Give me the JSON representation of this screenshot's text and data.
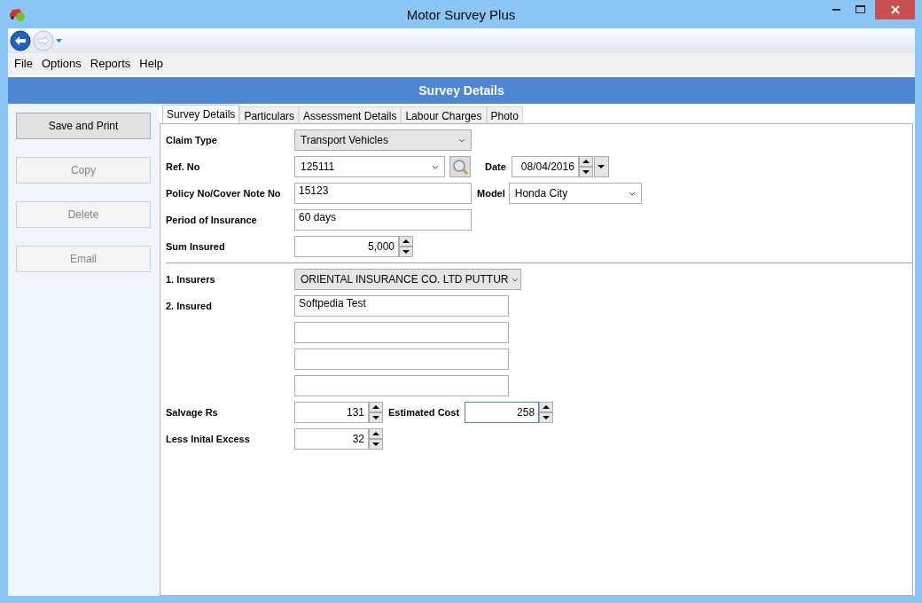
{
  "window": {
    "title": "Motor Survey Plus"
  },
  "menu": [
    "File",
    "Options",
    "Reports",
    "Help"
  ],
  "header": "Survey Details",
  "actions": [
    {
      "label": "Save and Print",
      "disabled": false
    },
    {
      "label": "Copy",
      "disabled": true
    },
    {
      "label": "Delete",
      "disabled": true
    },
    {
      "label": "Email",
      "disabled": true
    }
  ],
  "tabs": [
    {
      "label": "Survey Details",
      "selected": true
    },
    {
      "label": "Particulars",
      "selected": false
    },
    {
      "label": "Assessment Details",
      "selected": false
    },
    {
      "label": "Labour Charges",
      "selected": false
    },
    {
      "label": "Photo",
      "selected": false
    }
  ],
  "form": {
    "claim_type": {
      "label": "Claim Type",
      "value": "Transport Vehicles"
    },
    "ref_no": {
      "label": "Ref. No",
      "value": "125111"
    },
    "date": {
      "label": "Date",
      "value": "08/04/2016"
    },
    "policy_no": {
      "label": "Policy No/Cover Note No",
      "value": "15123"
    },
    "model": {
      "label": "Model",
      "value": "Honda City"
    },
    "period": {
      "label": "Period of Insurance",
      "value": "60 days"
    },
    "sum_insured": {
      "label": "Sum Insured",
      "value": "5,000",
      "focused": false
    },
    "insurers": {
      "label": "1. Insurers",
      "value": "ORIENTAL INSURANCE CO. LTD PUTTUR"
    },
    "insured": {
      "label": "2. Insured",
      "lines": [
        "Softpedia Test"
      ]
    },
    "salvage": {
      "label": "Salvage Rs",
      "value": "131",
      "focused": false
    },
    "estimated_cost": {
      "label": "Estimated Cost",
      "value": "258",
      "focused": true
    },
    "less_excess": {
      "label": "Less Inital Excess",
      "value": "32",
      "focused": false
    }
  }
}
